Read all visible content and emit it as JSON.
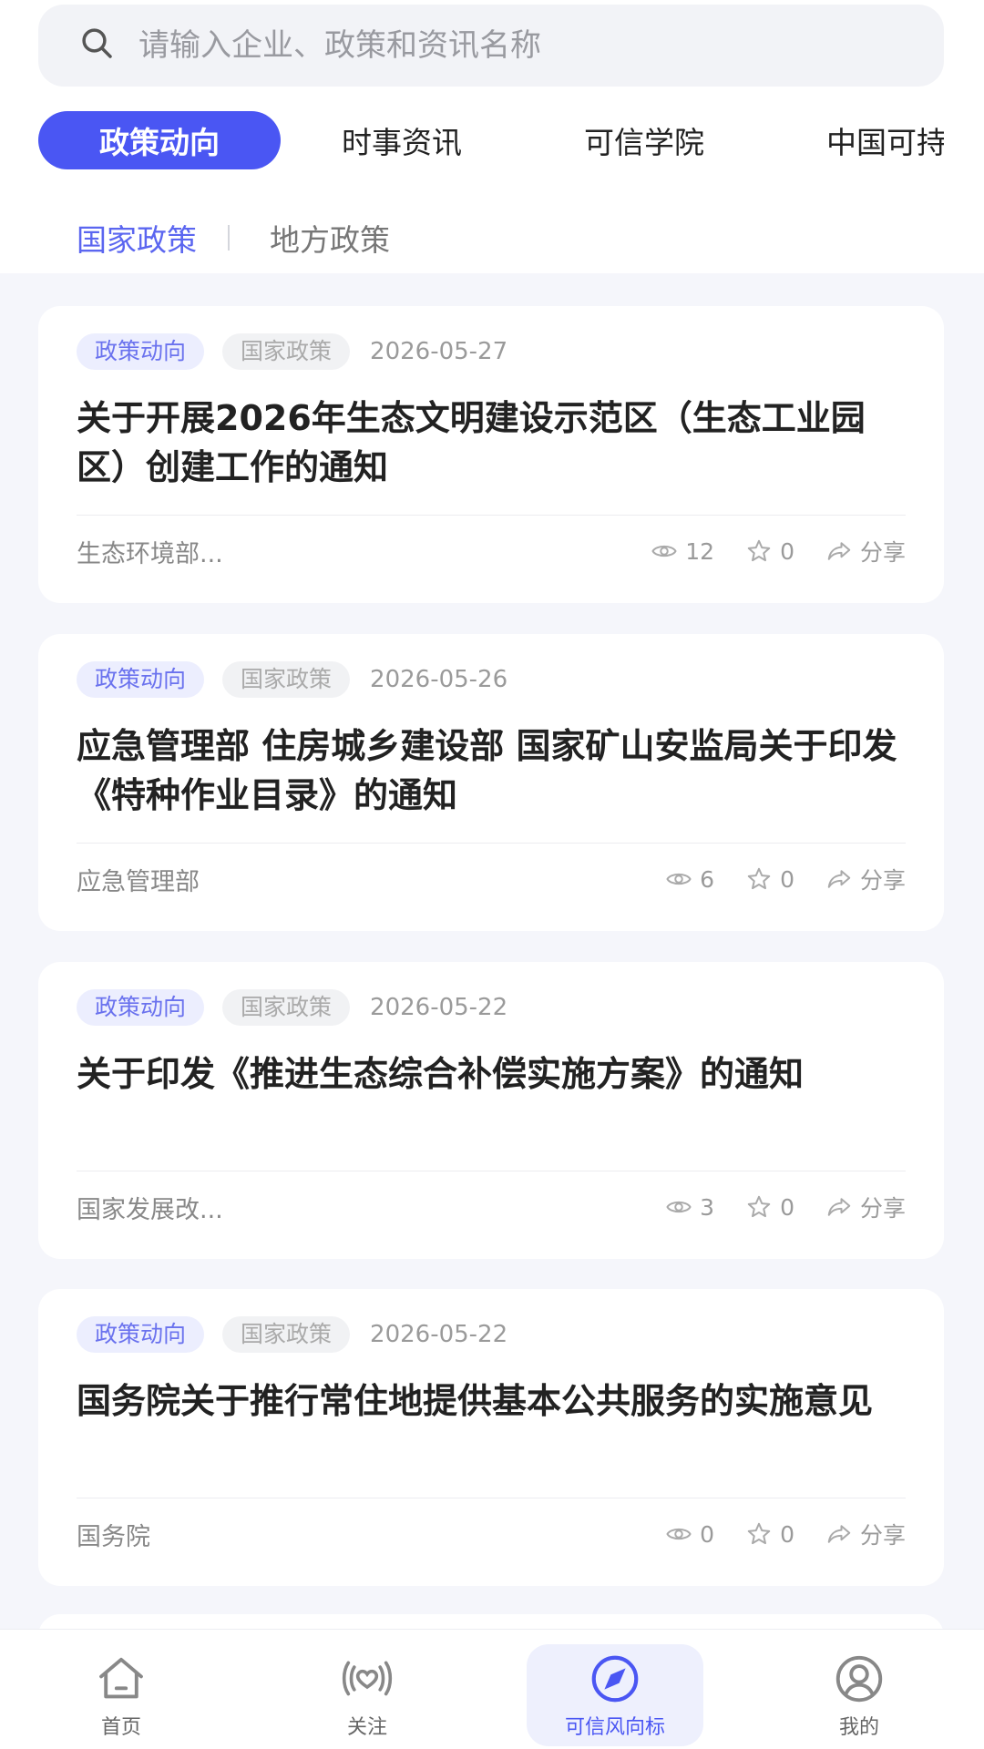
{
  "search": {
    "placeholder": "请输入企业、政策和资讯名称"
  },
  "tabs": [
    {
      "label": "政策动向"
    },
    {
      "label": "时事资讯"
    },
    {
      "label": "可信学院"
    },
    {
      "label": "中国可持"
    }
  ],
  "subtabs": [
    {
      "label": "国家政策"
    },
    {
      "label": "地方政策"
    }
  ],
  "articles": [
    {
      "tag1": "政策动向",
      "tag2": "国家政策",
      "date": "2026-05-27",
      "title": "关于开展2026年生态文明建设示范区（生态工业园区）创建工作的通知",
      "source": "生态环境部...",
      "views": "12",
      "favorites": "0",
      "share": "分享"
    },
    {
      "tag1": "政策动向",
      "tag2": "国家政策",
      "date": "2026-05-26",
      "title": "应急管理部 住房城乡建设部 国家矿山安监局关于印发《特种作业目录》的通知",
      "source": "应急管理部",
      "views": "6",
      "favorites": "0",
      "share": "分享"
    },
    {
      "tag1": "政策动向",
      "tag2": "国家政策",
      "date": "2026-05-22",
      "title": "关于印发《推进生态综合补偿实施方案》的通知",
      "source": "国家发展改...",
      "views": "3",
      "favorites": "0",
      "share": "分享"
    },
    {
      "tag1": "政策动向",
      "tag2": "国家政策",
      "date": "2026-05-22",
      "title": "国务院关于推行常住地提供基本公共服务的实施意见",
      "source": "国务院",
      "views": "0",
      "favorites": "0",
      "share": "分享"
    }
  ],
  "tabbar": [
    {
      "label": "首页",
      "icon": "home-icon"
    },
    {
      "label": "关注",
      "icon": "broadcast-heart-icon"
    },
    {
      "label": "可信风向标",
      "icon": "compass-icon"
    },
    {
      "label": "我的",
      "icon": "user-icon"
    }
  ],
  "colors": {
    "accent": "#4a56f3",
    "tagBlueText": "#6a72ee",
    "tagBlueBg": "#eceefe"
  }
}
